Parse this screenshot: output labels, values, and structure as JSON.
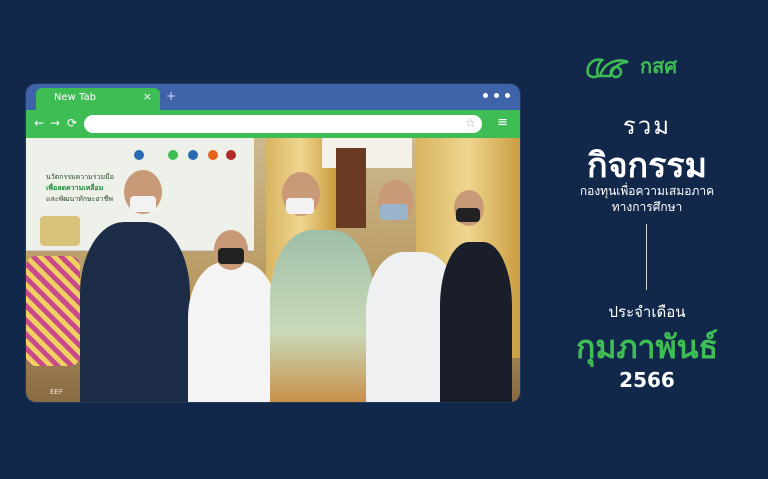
{
  "browser": {
    "tab_label": "New Tab",
    "tab_close": "×",
    "new_tab": "+",
    "back": "←",
    "forward": "→",
    "reload": "⟳",
    "bookmark": "☆",
    "menu": "≡",
    "url_value": ""
  },
  "brand": {
    "name": "กสศ",
    "color": "#3ebd54"
  },
  "headline": {
    "line1": "รวม",
    "line2": "กิจกรรม",
    "subtitle1": "กองทุนเพื่อความเสมอภาค",
    "subtitle2": "ทางการศึกษา"
  },
  "period": {
    "label": "ประจำเดือน",
    "month": "กุมภาพันธ์",
    "year": "2566"
  },
  "photo": {
    "backboard_line1": "นวัตกรรมความร่วมมือ",
    "backboard_line2": "เพื่อลดความเหลื่อม",
    "backboard_line3": "และพัฒนาทักษะอาชีพ",
    "corner_mark": "EEF"
  },
  "colors": {
    "background": "#12284a",
    "accent": "#3ebd54",
    "titlebar": "#3e63a9"
  }
}
